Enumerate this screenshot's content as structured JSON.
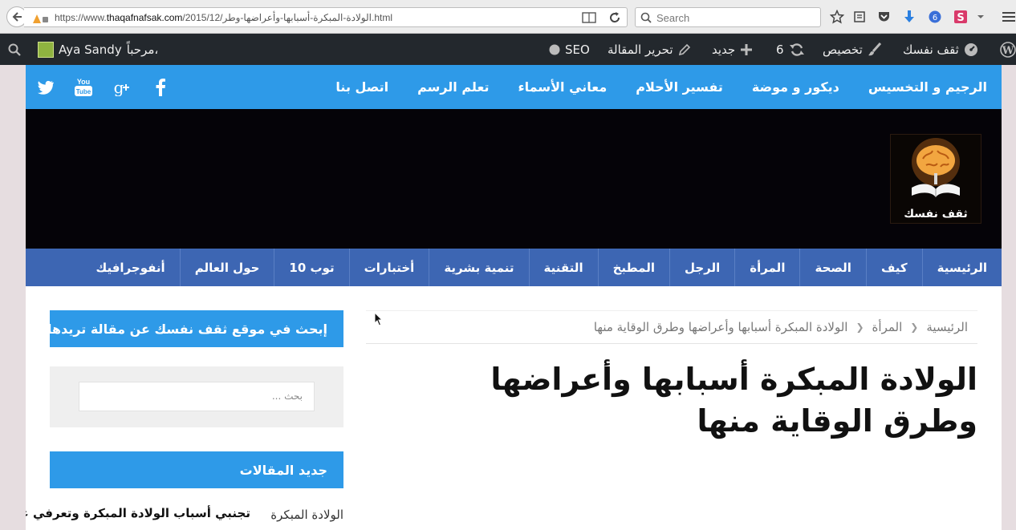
{
  "browser": {
    "url_prefix": "https://www.",
    "url_host": "thaqafnafsak.com",
    "url_path": "/2015/12/الولادة-المبكرة-أسبابها-وأعراضها-وطر.html",
    "search_placeholder": "Search"
  },
  "adminbar": {
    "site_name": "ثقف نفسك",
    "customize": "تخصيص",
    "updates_count": "6",
    "new": "جديد",
    "edit_post": "تحرير المقالة",
    "seo": "SEO",
    "greeting": "مرحباً،",
    "user_name": "Aya Sandy"
  },
  "topnav": {
    "items": [
      {
        "label": "الرجيم و التخسيس"
      },
      {
        "label": "ديكور و موضة"
      },
      {
        "label": "تفسير الأحلام"
      },
      {
        "label": "معاني الأسماء"
      },
      {
        "label": "تعلم الرسم"
      },
      {
        "label": "اتصل بنا"
      }
    ]
  },
  "logo": {
    "text": "ثقف نفسك"
  },
  "catnav": {
    "items": [
      {
        "label": "الرئيسية"
      },
      {
        "label": "كيف"
      },
      {
        "label": "الصحة"
      },
      {
        "label": "المرأة"
      },
      {
        "label": "الرجل"
      },
      {
        "label": "المطبخ"
      },
      {
        "label": "التقنية"
      },
      {
        "label": "تنمية بشرية"
      },
      {
        "label": "أختبارات"
      },
      {
        "label": "توب 10"
      },
      {
        "label": "حول العالم"
      },
      {
        "label": "أنفوجرافيك"
      }
    ]
  },
  "breadcrumb": {
    "home": "الرئيسية",
    "category": "المرأة",
    "current": "الولادة المبكرة أسبابها وأعراضها وطرق الوقاية منها"
  },
  "post": {
    "title": "الولادة المبكرة أسبابها وأعراضها وطرق الوقاية منها"
  },
  "sidebar": {
    "search_title": "إبحث في موقع ثقف نفسك عن مقالة تريدها",
    "search_placeholder": "بحث ...",
    "recent_title": "جديد المقالات",
    "recent_posts": [
      {
        "category": "الولادة المبكرة",
        "title": "تجنبي أسباب الولادة المبكرة وتعرفي على أعراضها"
      }
    ]
  },
  "colors": {
    "nav_blue": "#2e9ae8",
    "cat_blue": "#3d66b3",
    "admin_bar": "#23282d",
    "banner": "#050308"
  }
}
